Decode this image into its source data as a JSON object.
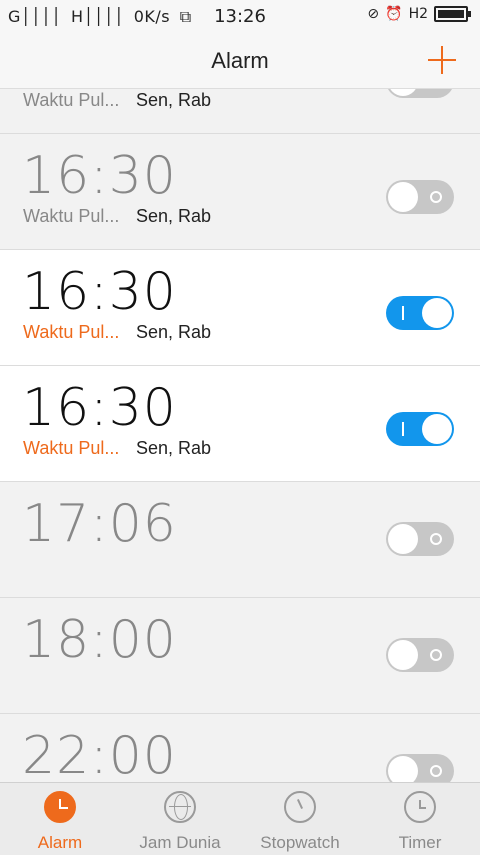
{
  "status_bar": {
    "signal1": "G││││",
    "signal2": "H││││",
    "speed": "0K/s",
    "time": "13:26",
    "network": "H2"
  },
  "header": {
    "title": "Alarm"
  },
  "alarms": [
    {
      "time": "",
      "label": "Waktu Pul...",
      "days": "Sen, Rab",
      "enabled": false
    },
    {
      "time": "16:30",
      "label": "Waktu Pul...",
      "days": "Sen, Rab",
      "enabled": false
    },
    {
      "time": "16:30",
      "label": "Waktu Pul...",
      "days": "Sen, Rab",
      "enabled": true
    },
    {
      "time": "16:30",
      "label": "Waktu Pul...",
      "days": "Sen, Rab",
      "enabled": true
    },
    {
      "time": "17:06",
      "label": "",
      "days": "",
      "enabled": false
    },
    {
      "time": "18:00",
      "label": "",
      "days": "",
      "enabled": false
    },
    {
      "time": "22:00",
      "label": "",
      "days": "",
      "enabled": false
    }
  ],
  "tabs": [
    {
      "label": "Alarm",
      "icon": "alarm-clock-icon",
      "active": true
    },
    {
      "label": "Jam Dunia",
      "icon": "globe-icon",
      "active": false
    },
    {
      "label": "Stopwatch",
      "icon": "stopwatch-icon",
      "active": false
    },
    {
      "label": "Timer",
      "icon": "timer-icon",
      "active": false
    }
  ],
  "colors": {
    "accent": "#ee6a1c",
    "toggle_on": "#1296ec",
    "toggle_off": "#c7c7c7"
  }
}
